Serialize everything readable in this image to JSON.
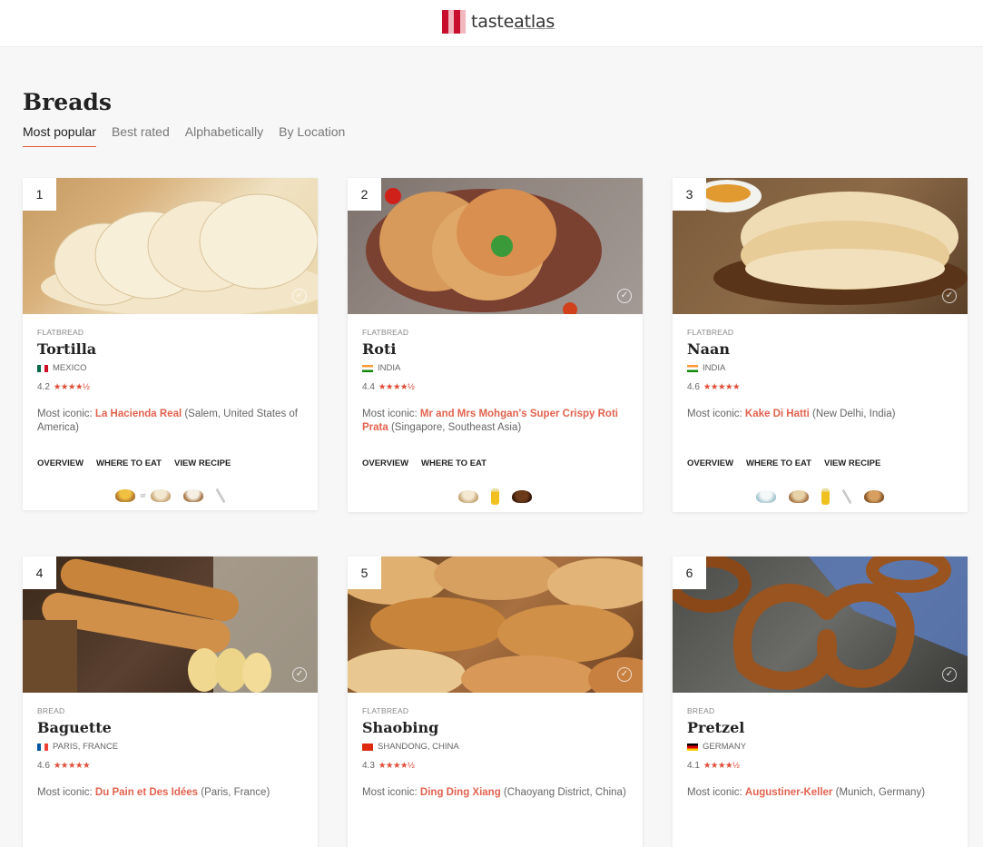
{
  "header": {
    "logo_text_pre": "taste",
    "logo_text_post": "atlas"
  },
  "page": {
    "title": "Breads"
  },
  "tabs": [
    {
      "label": "Most popular"
    },
    {
      "label": "Best rated"
    },
    {
      "label": "Alphabetically"
    },
    {
      "label": "By Location"
    }
  ],
  "colors": {
    "accent": "#e2624e",
    "stars": "#e04b36",
    "brand": "#c8102e"
  },
  "cards": [
    {
      "rank": "1",
      "category": "FLATBREAD",
      "name": "Tortilla",
      "location": "MEXICO",
      "flag": "mexico-flag",
      "rating": "4.2",
      "stars": "★★★★½",
      "iconic_prefix": "Most iconic: ",
      "iconic_place": "La Hacienda Real",
      "iconic_suffix": " (Salem, United States of America)",
      "links": [
        "OVERVIEW",
        "WHERE TO EAT",
        "VIEW RECIPE"
      ],
      "ingredients": [
        "corn-flour-icon",
        "or",
        "wheat-flour-icon",
        "flour-bowl-icon",
        "knife-icon"
      ]
    },
    {
      "rank": "2",
      "category": "FLATBREAD",
      "name": "Roti",
      "location": "INDIA",
      "flag": "india-flag",
      "rating": "4.4",
      "stars": "★★★★½",
      "iconic_prefix": "Most iconic: ",
      "iconic_place": "Mr and Mrs Mohgan's Super Crispy Roti Prata",
      "iconic_suffix": " (Singapore, Southeast Asia)",
      "links": [
        "OVERVIEW",
        "WHERE TO EAT"
      ],
      "ingredients": [
        "wheat-flour-icon",
        "oil-bottle-icon",
        "pot-icon"
      ]
    },
    {
      "rank": "3",
      "category": "FLATBREAD",
      "name": "Naan",
      "location": "INDIA",
      "flag": "india-flag",
      "rating": "4.6",
      "stars": "★★★★★",
      "iconic_prefix": "Most iconic: ",
      "iconic_place": "Kake Di Hatti",
      "iconic_suffix": " (New Delhi, India)",
      "links": [
        "OVERVIEW",
        "WHERE TO EAT",
        "VIEW RECIPE"
      ],
      "ingredients": [
        "yogurt-icon",
        "flour-icon",
        "oil-bottle-icon",
        "knife-icon",
        "clay-oven-icon"
      ]
    },
    {
      "rank": "4",
      "category": "BREAD",
      "name": "Baguette",
      "location": "PARIS, FRANCE",
      "flag": "france-flag",
      "rating": "4.6",
      "stars": "★★★★★",
      "iconic_prefix": "Most iconic: ",
      "iconic_place": "Du Pain et Des Idées",
      "iconic_suffix": " (Paris, France)"
    },
    {
      "rank": "5",
      "category": "FLATBREAD",
      "name": "Shaobing",
      "location": "SHANDONG, CHINA",
      "flag": "china-flag",
      "rating": "4.3",
      "stars": "★★★★½",
      "iconic_prefix": "Most iconic: ",
      "iconic_place": "Ding Ding Xiang",
      "iconic_suffix": " (Chaoyang District, China)"
    },
    {
      "rank": "6",
      "category": "BREAD",
      "name": "Pretzel",
      "location": "GERMANY",
      "flag": "germany-flag",
      "rating": "4.1",
      "stars": "★★★★½",
      "iconic_prefix": "Most iconic: ",
      "iconic_place": "Augustiner-Keller",
      "iconic_suffix": " (Munich, Germany)"
    }
  ]
}
